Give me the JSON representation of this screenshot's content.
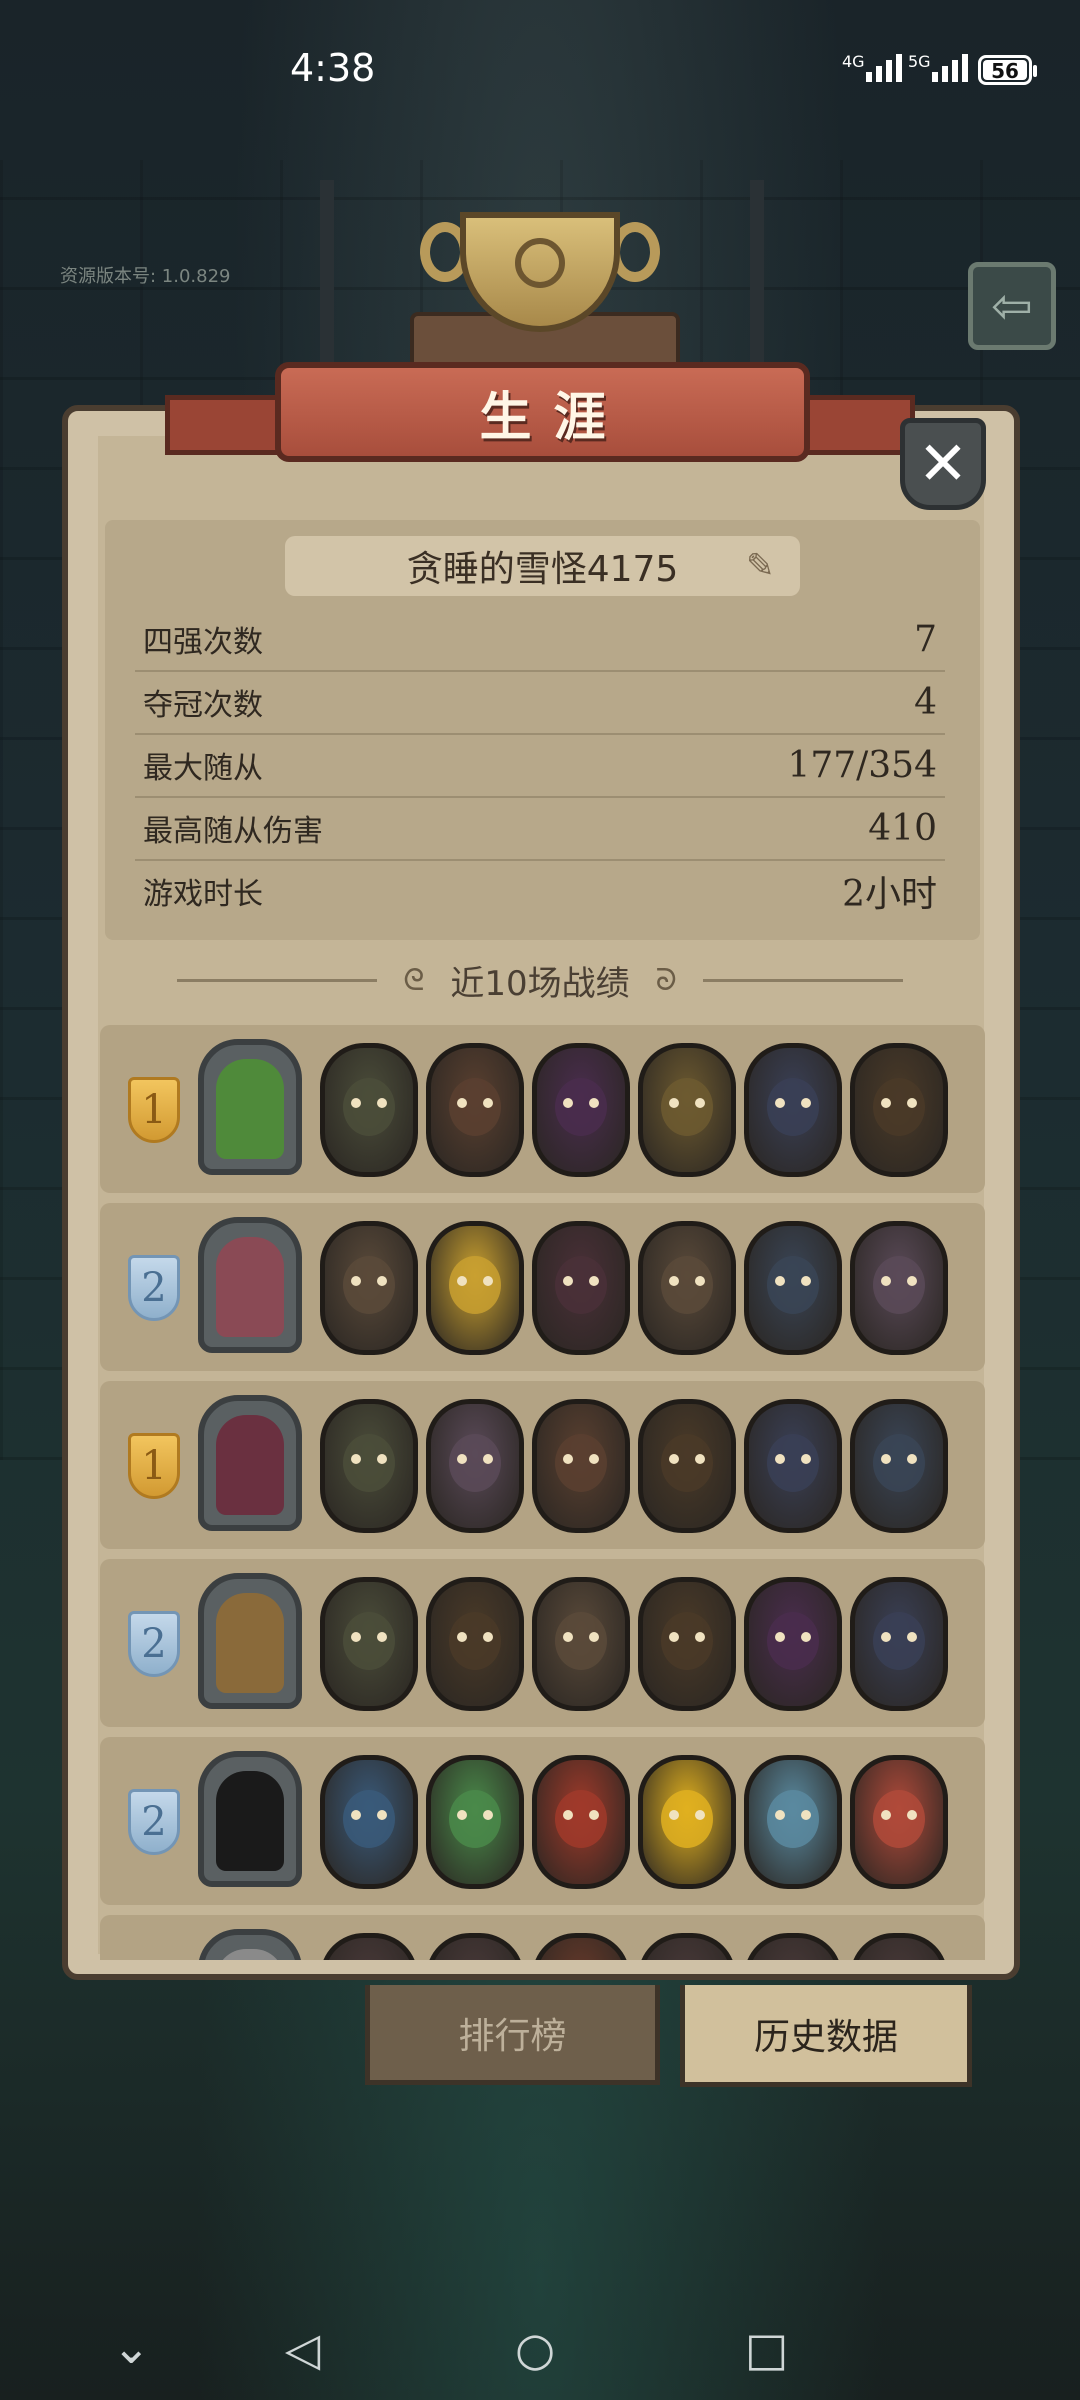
{
  "status_bar": {
    "time": "4:38",
    "net1": "4G",
    "net2": "5G",
    "battery": "56"
  },
  "version": "资源版本号: 1.0.829",
  "panel": {
    "title": "生涯",
    "player_name": "贪睡的雪怪4175",
    "stats": [
      {
        "label": "四强次数",
        "value": "7"
      },
      {
        "label": "夺冠次数",
        "value": "4"
      },
      {
        "label": "最大随从",
        "value": "177/354"
      },
      {
        "label": "最高随从伤害",
        "value": "410"
      },
      {
        "label": "游戏时长",
        "value": "2小时"
      }
    ],
    "section_title": "近10场战绩"
  },
  "matches": [
    {
      "rank": "1",
      "rank_style": "gold",
      "hero_color": "#4f8a3a",
      "minions": [
        "#4b4d3a",
        "#5a4030",
        "#4a2d4e",
        "#6d5a30",
        "#3a4056",
        "#4a3a28"
      ]
    },
    {
      "rank": "2",
      "rank_style": "blue",
      "hero_color": "#8a4a55",
      "minions": [
        "#5a4a3a",
        "#c9a030",
        "#4a3038",
        "#5a4a3a",
        "#3a4556",
        "#5a4a58"
      ]
    },
    {
      "rank": "1",
      "rank_style": "gold",
      "hero_color": "#6a3040",
      "minions": [
        "#4b4d3a",
        "#5a4a58",
        "#5a4030",
        "#4a3a28",
        "#3a4056",
        "#3a4556"
      ]
    },
    {
      "rank": "2",
      "rank_style": "blue",
      "hero_color": "#8a6a3a",
      "minions": [
        "#4b4d3a",
        "#4a3a28",
        "#5a4a3a",
        "#4a3a28",
        "#4a2d4e",
        "#3a4056"
      ]
    },
    {
      "rank": "2",
      "rank_style": "blue",
      "hero_color": "#1a1a1a",
      "minions": [
        "#3a5a7a",
        "#4a8a4a",
        "#a03a2a",
        "#e0b020",
        "#5a8aa0",
        "#b04a3a"
      ]
    },
    {
      "rank": "",
      "rank_style": "blue",
      "hero_color": "#8a8a8a",
      "minions": [
        "#4a3a3a",
        "#4a3a3a",
        "#6a3a2a",
        "#4a3a3a",
        "#4a3a3a",
        "#4a3a3a"
      ]
    }
  ],
  "tabs": {
    "leaderboard": "排行榜",
    "history": "历史数据"
  },
  "icons": {
    "back": "arrow-left-icon",
    "close": "close-icon",
    "edit": "pencil-icon",
    "trophy": "trophy-icon"
  }
}
